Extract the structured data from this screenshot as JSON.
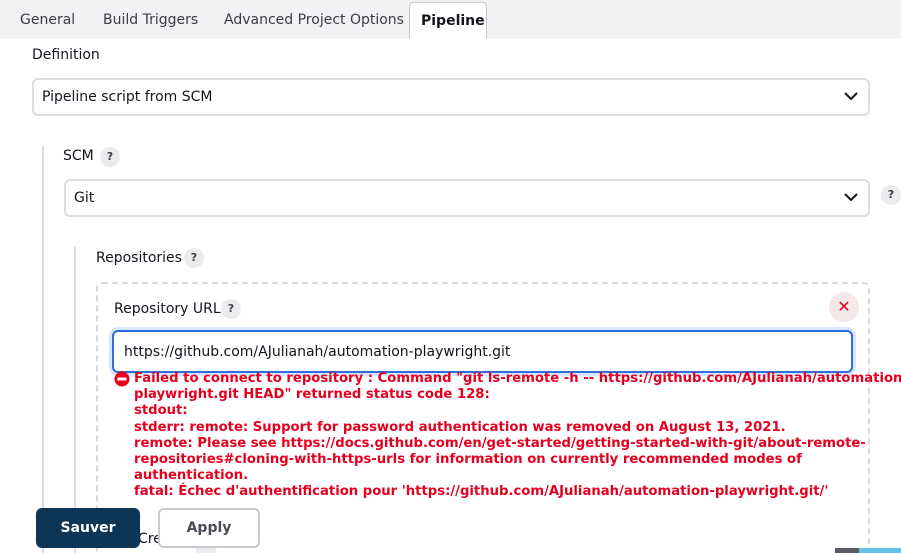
{
  "tabs": [
    {
      "label": "General"
    },
    {
      "label": "Build Triggers"
    },
    {
      "label": "Advanced Project Options"
    },
    {
      "label": "Pipeline",
      "active": true
    }
  ],
  "definition": {
    "label": "Definition",
    "selected": "Pipeline script from SCM"
  },
  "scm": {
    "label": "SCM",
    "help": "?",
    "selected": "Git",
    "outer_help": "?"
  },
  "repositories": {
    "label": "Repositories",
    "help": "?",
    "close": "✕",
    "url_label": "Repository URL",
    "url_help": "?",
    "url_value": "https://github.com/AJulianah/automation-playwright.git",
    "error_lines": [
      "Failed to connect to repository : Command \"git ls-remote -h -- https://github.com/AJulianah/automation-",
      "playwright.git HEAD\" returned status code 128:",
      "stdout:",
      "stderr: remote: Support for password authentication was removed on August 13, 2021.",
      "remote: Please see https://docs.github.com/en/get-started/getting-started-with-git/about-remote-",
      "repositories#cloning-with-https-urls for information on currently recommended modes of",
      "authentication.",
      "fatal: Échec d'authentification pour 'https://github.com/AJulianah/automation-playwright.git/'"
    ],
    "partial_label": "Credentials"
  },
  "buttons": {
    "save": "Sauver",
    "apply": "Apply"
  },
  "colors": {
    "error": "#e6001f",
    "primary": "#0d3656",
    "focus": "#2c6fd6"
  }
}
